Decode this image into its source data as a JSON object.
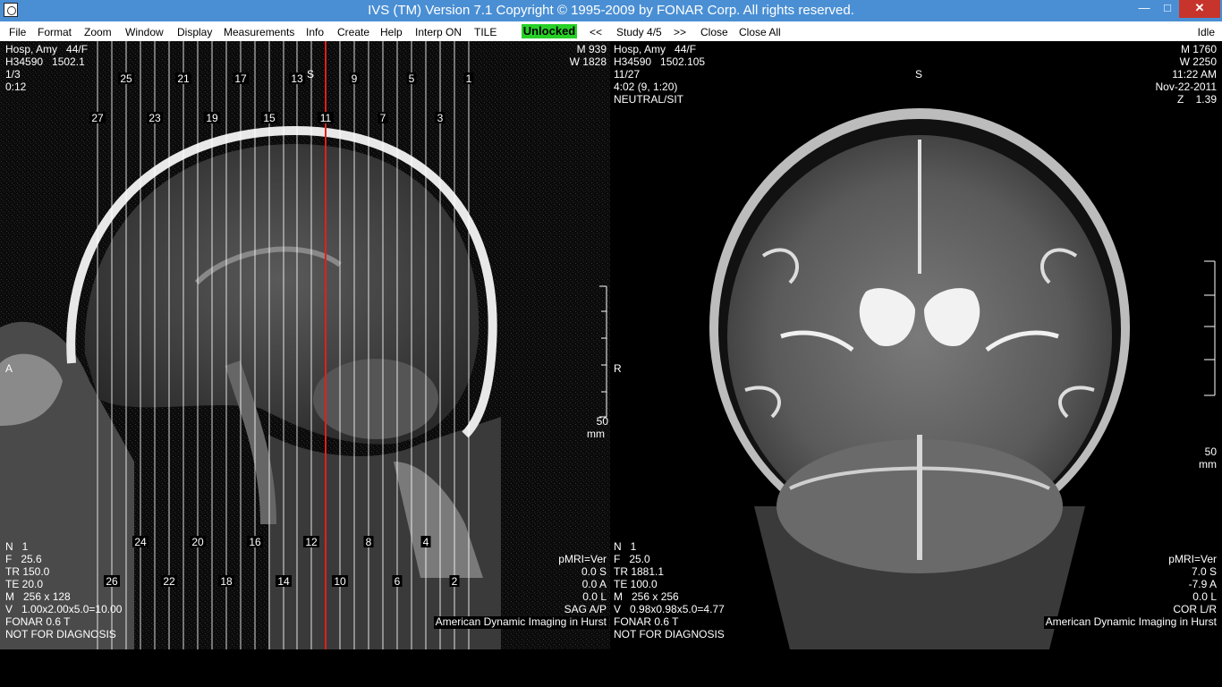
{
  "window": {
    "title": "IVS (TM) Version 7.1 Copyright © 1995-2009 by FONAR Corp. All rights reserved.",
    "minimize": "—",
    "maximize": "□",
    "close": "✕"
  },
  "menu": {
    "file": "File",
    "format": "Format",
    "zoom": "Zoom",
    "window": "Window",
    "display": "Display",
    "measurements": "Measurements",
    "info": "Info",
    "create": "Create",
    "help": "Help",
    "interp": "Interp ON",
    "tile": "TILE",
    "unlocked": "Unlocked",
    "prev": "<<",
    "study": "Study 4/5",
    "next": ">>",
    "close": "Close",
    "close_all": "Close All",
    "status": "Idle"
  },
  "left_view": {
    "patient": "Hosp, Amy   44/F",
    "id": "H34590   1502.1",
    "series": "1/3",
    "time": "0:12",
    "m": "M 939",
    "w": "W 1828",
    "orient_top": "S",
    "orient_left": "A",
    "scale": "50",
    "scale_unit": "mm",
    "n": "N   1",
    "f": "F   25.6",
    "tr": "TR 150.0",
    "te": "TE 20.0",
    "matrix": "M   256 x 128",
    "voxel": "V   1.00x2.00x5.0=10.00",
    "field": "FONAR 0.6 T",
    "disclaimer": "NOT FOR DIAGNOSIS",
    "pmri": "pMRI=Ver",
    "pos_s": "0.0 S",
    "pos_a": "0.0 A",
    "pos_l": "0.0 L",
    "plane": "SAG A/P",
    "site": "American Dynamic Imaging in Hurst",
    "slice_labels": [
      "1",
      "2",
      "3",
      "4",
      "5",
      "6",
      "7",
      "8",
      "9",
      "10",
      "11",
      "12",
      "13",
      "14",
      "15",
      "16",
      "17",
      "18",
      "19",
      "20",
      "21",
      "22",
      "23",
      "24",
      "25",
      "26",
      "27"
    ]
  },
  "right_view": {
    "patient": "Hosp, Amy   44/F",
    "id": "H34590   1502.105",
    "series": "11/27",
    "time": "4:02 (9, 1:20)",
    "position": "NEUTRAL/SIT",
    "m": "M 1760",
    "w": "W 2250",
    "clock": "11:22 AM",
    "date": "Nov-22-2011",
    "zoom": "Z    1.39",
    "orient_top": "S",
    "orient_left": "R",
    "scale": "50",
    "scale_unit": "mm",
    "n": "N   1",
    "f": "F   25.0",
    "tr": "TR 1881.1",
    "te": "TE 100.0",
    "matrix": "M   256 x 256",
    "voxel": "V   0.98x0.98x5.0=4.77",
    "field": "FONAR 0.6 T",
    "disclaimer": "NOT FOR DIAGNOSIS",
    "pmri": "pMRI=Ver",
    "pos_s": "7.0 S",
    "pos_a": "-7.9 A",
    "pos_l": "0.0 L",
    "plane": "COR L/R",
    "site": "American Dynamic Imaging in Hurst"
  },
  "colors": {
    "titlebar": "#4a8fd4",
    "unlocked": "#27d127",
    "active_slice": "#e0201c"
  }
}
